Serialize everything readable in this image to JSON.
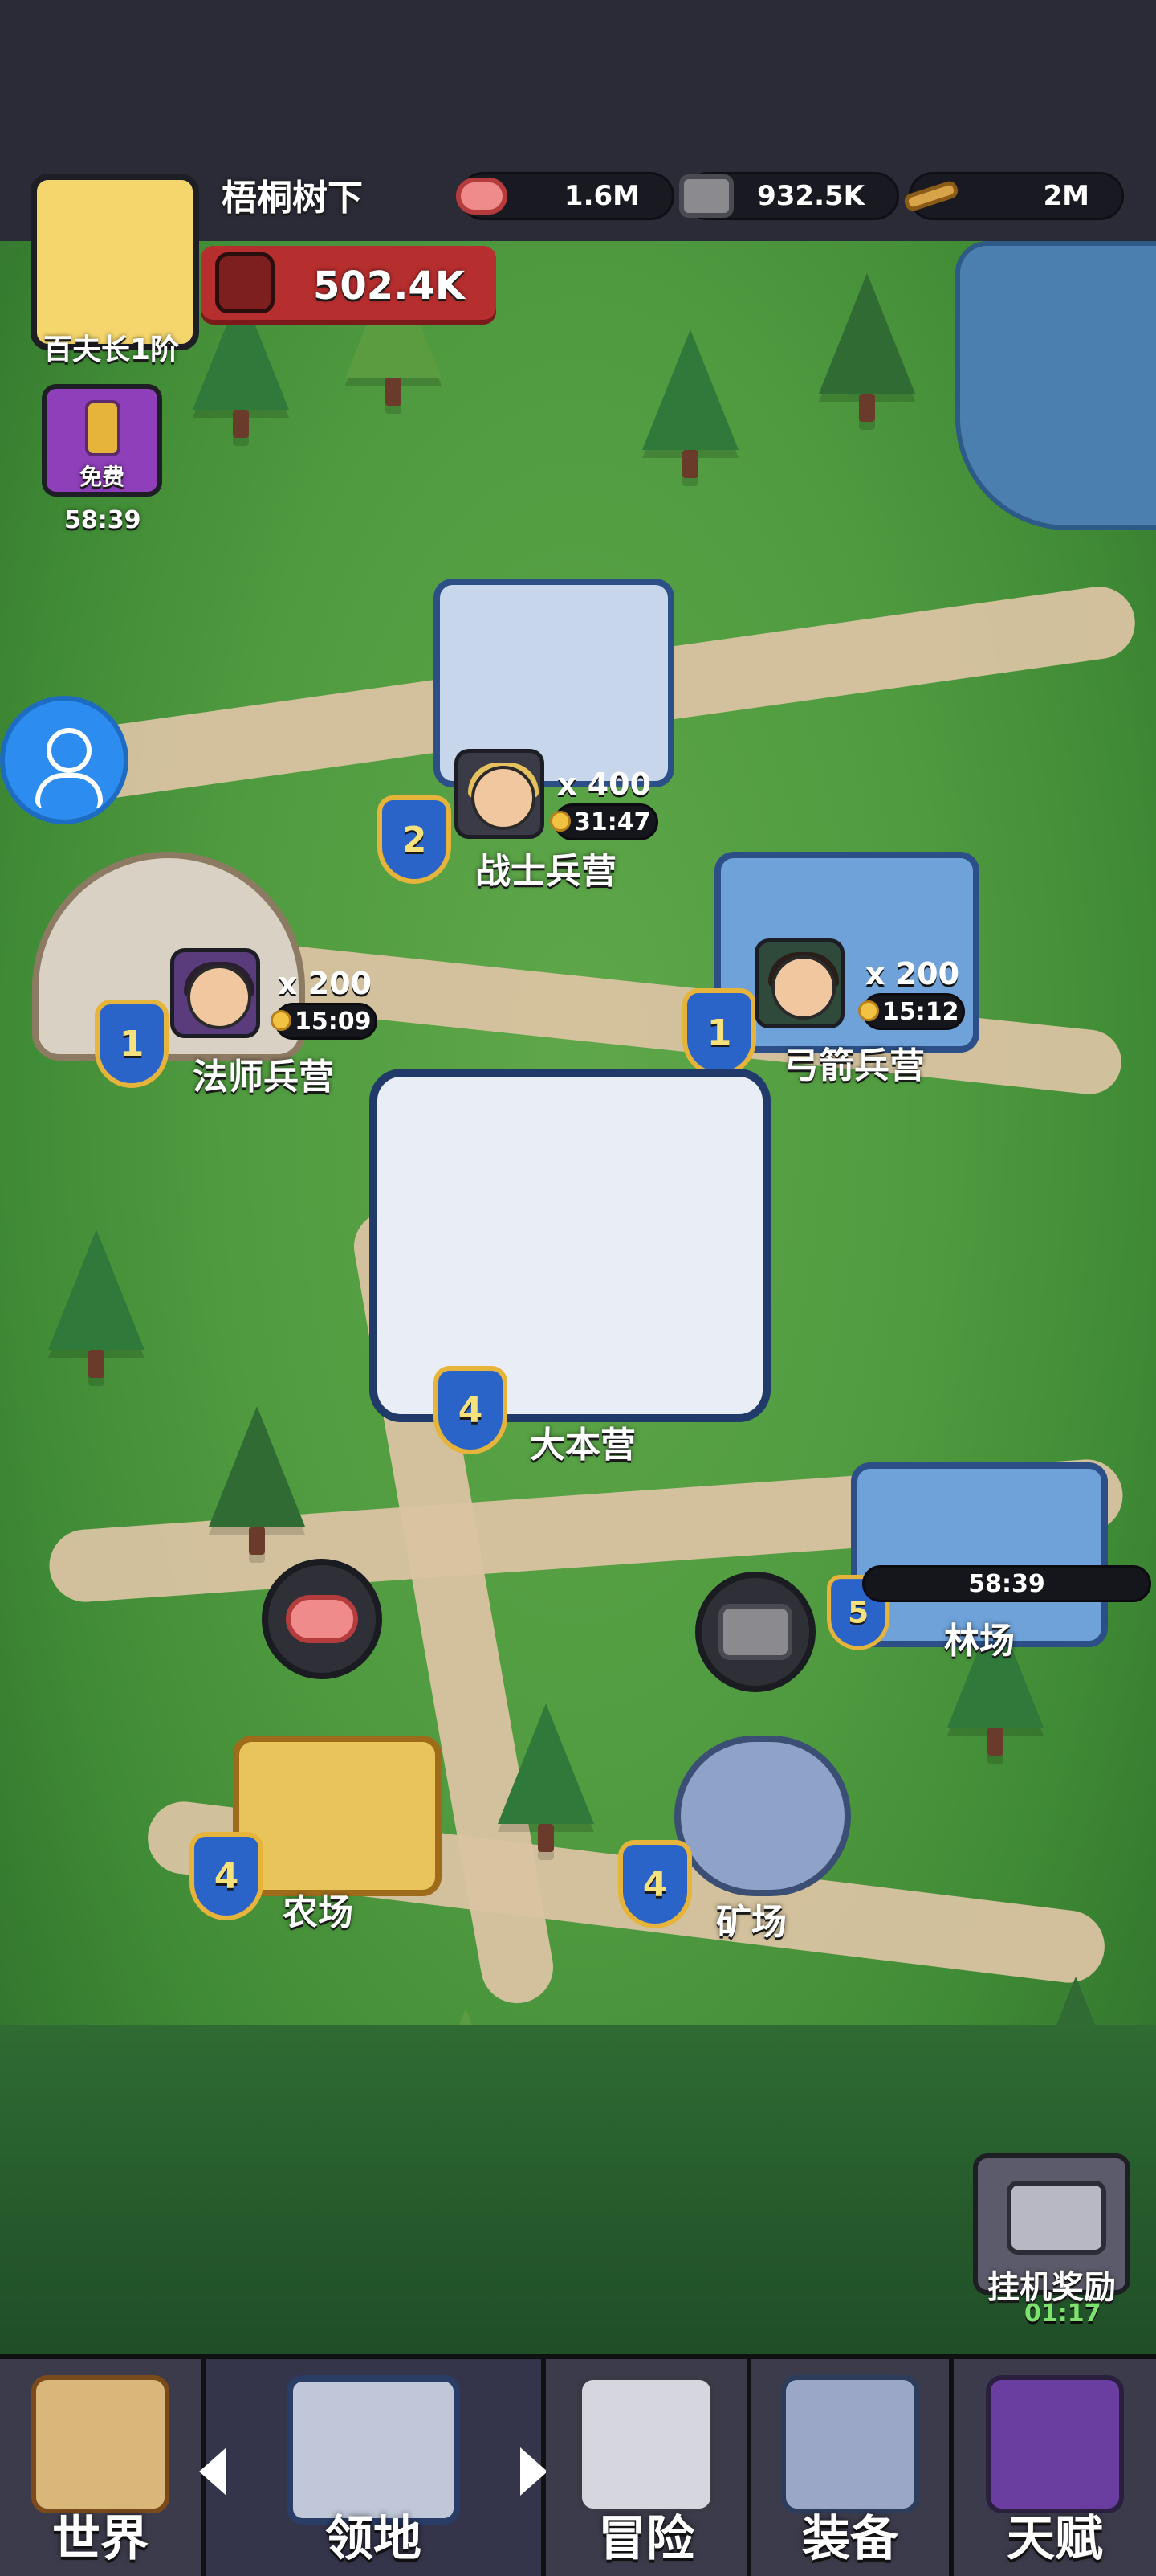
{
  "player": {
    "name": "梧桐树下",
    "rank": "百夫长1阶",
    "power": "502.4K"
  },
  "resources": [
    {
      "icon": "meat-icon",
      "value": "1.6M"
    },
    {
      "icon": "stone-icon",
      "value": "932.5K"
    },
    {
      "icon": "wood-icon",
      "value": "2M"
    }
  ],
  "free_timer": {
    "label": "免费",
    "time": "58:39"
  },
  "buildings": {
    "warrior_barracks": {
      "name": "战士兵营",
      "level": "2",
      "count": "x 400",
      "time": "31:47"
    },
    "mage_barracks": {
      "name": "法师兵营",
      "level": "1",
      "count": "x 200",
      "time": "15:09"
    },
    "archer_barracks": {
      "name": "弓箭兵营",
      "level": "1",
      "count": "x 200",
      "time": "15:12"
    },
    "headquarters": {
      "name": "大本营",
      "level": "4"
    },
    "lumber_yard": {
      "name": "林场",
      "level": "5",
      "time": "58:39"
    },
    "farm": {
      "name": "农场",
      "level": "4"
    },
    "mine": {
      "name": "矿场",
      "level": "4"
    }
  },
  "idle_reward": {
    "label": "挂机奖励",
    "time": "01:17"
  },
  "bottom_nav": [
    {
      "id": "world",
      "label": "世界"
    },
    {
      "id": "territory",
      "label": "领地"
    },
    {
      "id": "adventure",
      "label": "冒险"
    },
    {
      "id": "equipment",
      "label": "装备"
    },
    {
      "id": "talent",
      "label": "天赋"
    }
  ],
  "colors": {
    "map_green": "#4f9a3f",
    "path": "#d9c3a1",
    "badge_blue": "#2b64c9",
    "badge_gold": "#e7b43b",
    "banner_red": "#b72e2e",
    "timer_green": "#7ee36e"
  }
}
